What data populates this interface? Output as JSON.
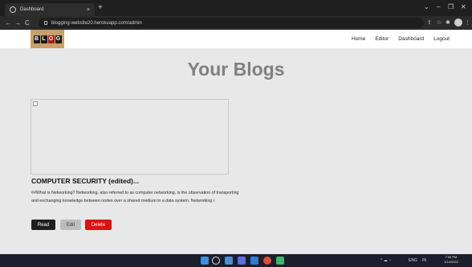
{
  "browser": {
    "tab_title": "Dashboard",
    "tab_close": "×",
    "new_tab": "+",
    "url": "blogging-website20.herokuapp.com/admin",
    "window_controls": [
      "⌄",
      "–",
      "❐",
      "✕"
    ],
    "nav": {
      "back": "←",
      "forward": "→",
      "reload": "C"
    }
  },
  "site": {
    "logo_letters": [
      "B",
      "L",
      "O",
      "G"
    ],
    "nav": [
      "Home",
      "Editor",
      "Dashboard",
      "Logout"
    ]
  },
  "main": {
    "title": "Your Blogs",
    "card": {
      "title": "COMPUTER SECURITY (edited)...",
      "excerpt": "##What is Networking? Networking, also referred to as computer networking, is the observation of transporting and exchanging knowledge between nodes over a shared medium in a data system. Networking i",
      "buttons": {
        "read": "Read",
        "edit": "Edit",
        "delete": "Delete"
      }
    }
  },
  "taskbar": {
    "tray": {
      "weather": "ENG",
      "lang": "IN",
      "clock_time": "7:53 PM",
      "clock_date": "1/14/2022"
    }
  }
}
